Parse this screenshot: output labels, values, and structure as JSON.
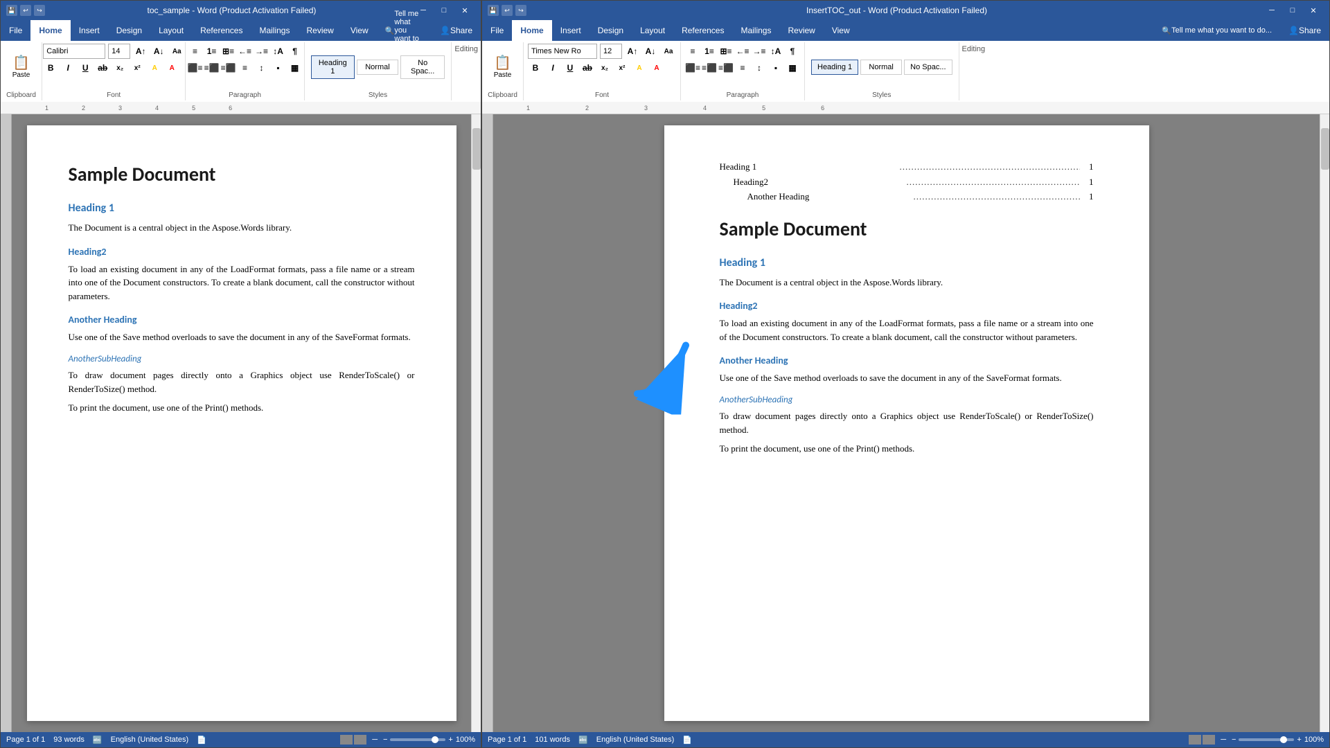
{
  "left_window": {
    "title": "toc_sample - Word (Product Activation Failed)",
    "tabs": [
      "File",
      "Home",
      "Insert",
      "Design",
      "Layout",
      "References",
      "Mailings",
      "Review",
      "View"
    ],
    "active_tab": "Home",
    "tell_me": "Tell me what you want to do...",
    "share": "Share",
    "font_name": "Calibri",
    "font_size": "14",
    "editing_label": "Editing",
    "clipboard_label": "Clipboard",
    "font_label": "Font",
    "paragraph_label": "Paragraph",
    "styles_label": "Styles",
    "styles": [
      "Heading 1",
      "Normal",
      "No Spac..."
    ],
    "style_active": "Heading 1",
    "status": {
      "page": "Page 1 of 1",
      "words": "93 words",
      "language": "English (United States)",
      "zoom": "100%"
    },
    "document": {
      "title": "Sample Document",
      "sections": [
        {
          "heading": "Heading 1",
          "heading_level": 1,
          "body": "The Document  is a central object  in the Aspose.Words   library."
        },
        {
          "heading": "Heading2",
          "heading_level": 2,
          "body": "To load an existing  document  in any of the LoadFormat  formats, pass a file  name  or a stream  into one of the  Document constructors.  To create a blank document,  call the constructor without  parameters."
        },
        {
          "heading": "Another Heading",
          "heading_level": 2,
          "body": "Use one of the Save  method  overloads  to save the document in any of the SaveFormat  formats."
        },
        {
          "heading": "AnotherSubHeading",
          "heading_level": 3,
          "body1": "To draw document  pages  directly  onto a Graphics  object use RenderToScale()   or RenderToSize()   method.",
          "body2": "To print the document,  use one of the Print() methods."
        }
      ]
    }
  },
  "right_window": {
    "title": "InsertTOC_out - Word (Product Activation Failed)",
    "tabs": [
      "File",
      "Home",
      "Insert",
      "Design",
      "Layout",
      "References",
      "Mailings",
      "Review",
      "View"
    ],
    "active_tab": "Home",
    "tell_me": "Tell me what you want to do...",
    "share": "Share",
    "font_name": "Times New Ro",
    "font_size": "12",
    "editing_label": "Editing",
    "clipboard_label": "Clipboard",
    "font_label": "Font",
    "paragraph_label": "Paragraph",
    "styles_label": "Styles",
    "styles": [
      "Heading 1",
      "Normal",
      "No Spac..."
    ],
    "style_active": "Heading 1",
    "status": {
      "page": "Page 1 of 1",
      "words": "101 words",
      "language": "English (United States)",
      "zoom": "100%"
    },
    "document": {
      "toc": [
        {
          "indent": 1,
          "label": "Heading 1",
          "page": "1"
        },
        {
          "indent": 2,
          "label": "Heading2",
          "page": "1"
        },
        {
          "indent": 3,
          "label": "Another Heading",
          "page": "1"
        }
      ],
      "title": "Sample Document",
      "sections": [
        {
          "heading": "Heading 1",
          "heading_level": 1,
          "body": "The Document  is a central object  in the Aspose.Words   library."
        },
        {
          "heading": "Heading2",
          "heading_level": 2,
          "body": "To load an existing  document  in any of the LoadFormat  formats, pass a file  name  or a stream  into one of the  Document constructors.  To create a blank document,  call the constructor without  parameters."
        },
        {
          "heading": "Another Heading",
          "heading_level": 2,
          "body": "Use one of the Save  method  overloads  to save the document in any of the SaveFormat  formats."
        },
        {
          "heading": "AnotherSubHeading",
          "heading_level": 3,
          "body1": "To draw document  pages  directly  onto a Graphics  object use RenderToScale()   or RenderToSize()   method.",
          "body2": "To print the document,  use one of the Print() methods."
        }
      ]
    }
  },
  "arrow": {
    "color": "#1e90ff",
    "direction": "right-up"
  }
}
